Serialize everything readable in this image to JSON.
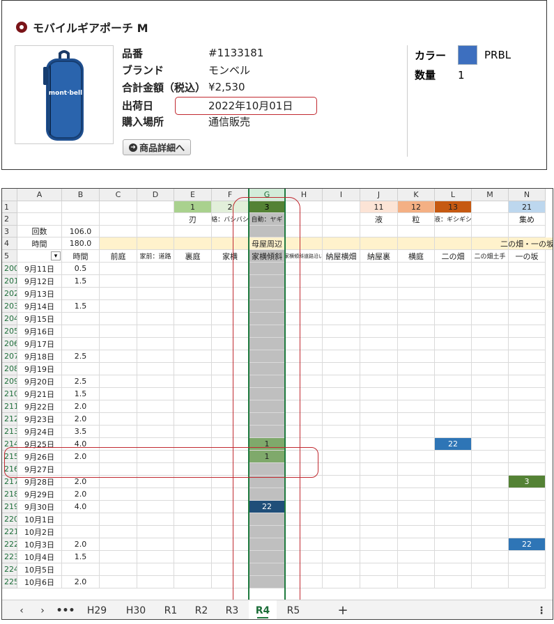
{
  "product": {
    "title": "モバイルギアポーチ M",
    "image_brand_text": "mont·bell",
    "fields": [
      {
        "label": "品番",
        "value": "#1133181"
      },
      {
        "label": "ブランド",
        "value": "モンベル"
      },
      {
        "label": "合計金額（税込）",
        "value": "¥2,530"
      },
      {
        "label": "出荷日",
        "value": "2022年10月01日"
      },
      {
        "label": "購入場所",
        "value": "通信販売"
      }
    ],
    "detail_button": "商品詳細へ",
    "color_label": "カラー",
    "color_value": "PRBL",
    "color_swatch": "#3d6fbf",
    "qty_label": "数量",
    "qty_value": "1"
  },
  "sheet": {
    "columns": [
      "A",
      "B",
      "C",
      "D",
      "E",
      "F",
      "G",
      "H",
      "I",
      "J",
      "K",
      "L",
      "M",
      "N"
    ],
    "row1": {
      "E": "1",
      "F": "2",
      "G": "3",
      "J": "11",
      "K": "12",
      "L": "13",
      "N": "21"
    },
    "row2": {
      "E": "刃",
      "F": "絡：バシバシ",
      "G": "自動：ヤギ",
      "J": "液",
      "K": "粒",
      "L": "液：ギシギシ",
      "N": "集め"
    },
    "row3": {
      "A": "回数",
      "B": "106.0"
    },
    "row4": {
      "A": "時間",
      "B": "180.0",
      "G": "母屋周辺",
      "N": "二の畑・一の坂"
    },
    "row5": {
      "B": "時間",
      "C": "前庭",
      "D": "家前：道路",
      "E": "裏庭",
      "F": "家横",
      "G": "家横傾斜",
      "H": "家横傾斜道路沿い",
      "I": "納屋横畑",
      "J": "納屋裏",
      "K": "横庭",
      "L": "二の畑",
      "M": "二の畑土手",
      "N": "一の坂"
    },
    "rows": [
      {
        "n": "200",
        "date": "9月11日",
        "time": "0.5"
      },
      {
        "n": "201",
        "date": "9月12日",
        "time": "1.5"
      },
      {
        "n": "202",
        "date": "9月13日",
        "time": ""
      },
      {
        "n": "203",
        "date": "9月14日",
        "time": "1.5"
      },
      {
        "n": "204",
        "date": "9月15日",
        "time": ""
      },
      {
        "n": "205",
        "date": "9月16日",
        "time": ""
      },
      {
        "n": "206",
        "date": "9月17日",
        "time": ""
      },
      {
        "n": "207",
        "date": "9月18日",
        "time": "2.5"
      },
      {
        "n": "208",
        "date": "9月19日",
        "time": ""
      },
      {
        "n": "209",
        "date": "9月20日",
        "time": "2.5"
      },
      {
        "n": "210",
        "date": "9月21日",
        "time": "1.5"
      },
      {
        "n": "211",
        "date": "9月22日",
        "time": "2.0"
      },
      {
        "n": "212",
        "date": "9月23日",
        "time": "2.0"
      },
      {
        "n": "213",
        "date": "9月24日",
        "time": "3.5"
      },
      {
        "n": "214",
        "date": "9月25日",
        "time": "4.0",
        "G": "1",
        "L": "22"
      },
      {
        "n": "215",
        "date": "9月26日",
        "time": "2.0",
        "G": "1"
      },
      {
        "n": "216",
        "date": "9月27日",
        "time": ""
      },
      {
        "n": "217",
        "date": "9月28日",
        "time": "2.0",
        "N": "3"
      },
      {
        "n": "218",
        "date": "9月29日",
        "time": "2.0"
      },
      {
        "n": "219",
        "date": "9月30日",
        "time": "4.0",
        "G": "22"
      },
      {
        "n": "220",
        "date": "10月1日",
        "time": ""
      },
      {
        "n": "221",
        "date": "10月2日",
        "time": ""
      },
      {
        "n": "222",
        "date": "10月3日",
        "time": "2.0",
        "N": "22"
      },
      {
        "n": "223",
        "date": "10月4日",
        "time": "1.5"
      },
      {
        "n": "224",
        "date": "10月5日",
        "time": ""
      },
      {
        "n": "225",
        "date": "10月6日",
        "time": "2.0"
      }
    ],
    "tabs": [
      "H29",
      "H30",
      "R1",
      "R2",
      "R3",
      "R4",
      "R5"
    ],
    "active_tab": "R4",
    "colors": {
      "c1": "#a9d18e",
      "c2": "#e2efda",
      "c3": "#548235",
      "c11": "#fce4d6",
      "c12": "#f4b084",
      "c13": "#c65911",
      "c21": "#bdd7ee",
      "c_sel_green": "#7fa96b",
      "c_blue": "#2e75b6",
      "c_darkblue": "#1f4e79",
      "c_olive": "#548235"
    }
  }
}
